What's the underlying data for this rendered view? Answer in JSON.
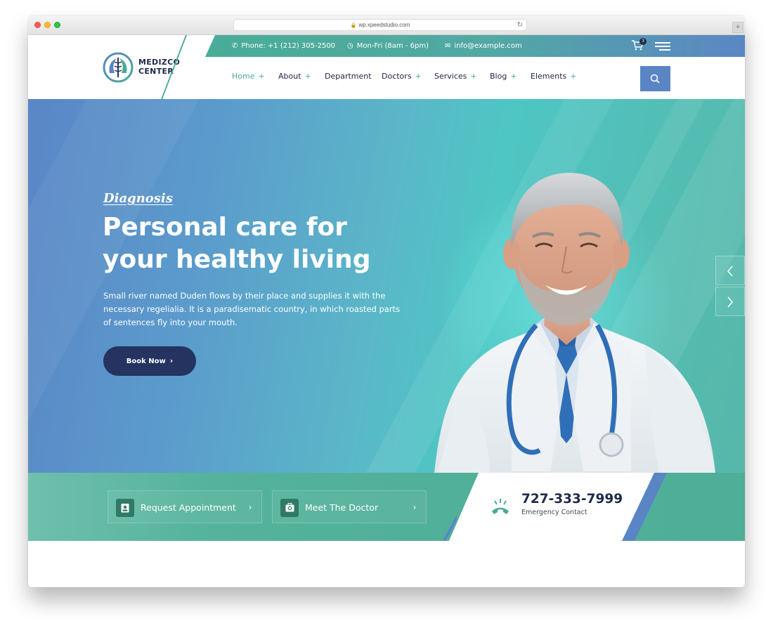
{
  "browser": {
    "url": "wp.xpeedstudio.com",
    "new_tab_symbol": "+"
  },
  "brand": {
    "line1": "MEDIZCO",
    "line2": "CENTER",
    "primary_color": "#49ab95",
    "accent_blue": "#5a85c5",
    "navy": "#24335f"
  },
  "topbar": {
    "phone": "Phone: +1 (212) 305-2500",
    "hours": "Mon-Fri (8am - 6pm)",
    "email": "info@example.com",
    "cart_count": "3"
  },
  "nav": {
    "items": [
      {
        "label": "Home",
        "plus": "+"
      },
      {
        "label": "About",
        "plus": "+"
      },
      {
        "label": "Department",
        "plus": ""
      },
      {
        "label": "Doctors",
        "plus": "+"
      },
      {
        "label": "Services",
        "plus": "+"
      },
      {
        "label": "Blog",
        "plus": "+"
      },
      {
        "label": "Elements",
        "plus": "+"
      }
    ]
  },
  "hero": {
    "eyebrow": "Diagnosis",
    "title": "Personal care for your healthy living",
    "text": "Small river named Duden flows by their place and supplies it with the necessary regelialia. It is a paradisematic country, in which roasted parts of sentences fly into your mouth.",
    "button": "Book Now"
  },
  "strip": {
    "appointment": "Request Appointment",
    "doctor": "Meet The Doctor",
    "phone": "727-333-7999",
    "phone_label": "Emergency Contact"
  }
}
